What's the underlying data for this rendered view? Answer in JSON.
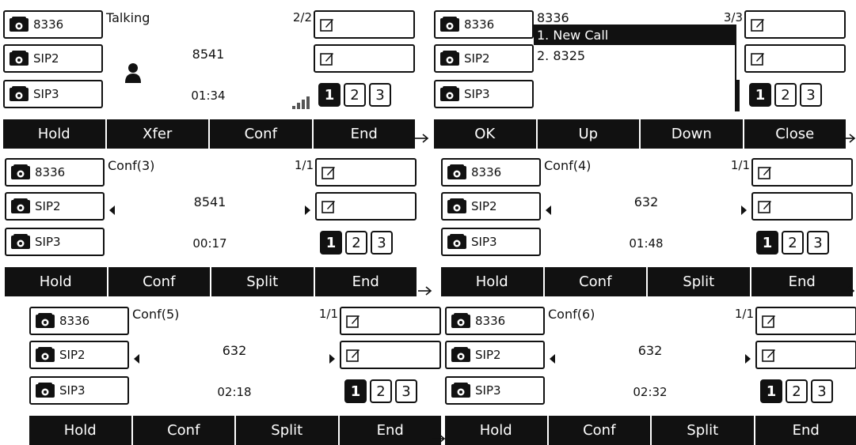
{
  "screens": [
    {
      "accounts": [
        "8336",
        "SIP2",
        "SIP3"
      ],
      "title": "Talking",
      "count": "2/2",
      "number": "8541",
      "time": "01:34",
      "pages": [
        "1",
        "2",
        "3"
      ],
      "softkeys": [
        "Hold",
        "Xfer",
        "Conf",
        "End"
      ]
    },
    {
      "accounts": [
        "8336",
        "SIP2",
        "SIP3"
      ],
      "title": "8336",
      "count": "3/3",
      "menu_items": [
        "1. New Call",
        "2. 8325"
      ],
      "pages": [
        "1",
        "2",
        "3"
      ],
      "softkeys": [
        "OK",
        "Up",
        "Down",
        "Close"
      ]
    },
    {
      "accounts": [
        "8336",
        "SIP2",
        "SIP3"
      ],
      "title": "Conf(3)",
      "count": "1/1",
      "number": "8541",
      "time": "00:17",
      "pages": [
        "1",
        "2",
        "3"
      ],
      "softkeys": [
        "Hold",
        "Conf",
        "Split",
        "End"
      ]
    },
    {
      "accounts": [
        "8336",
        "SIP2",
        "SIP3"
      ],
      "title": "Conf(4)",
      "count": "1/1",
      "number": "632",
      "time": "01:48",
      "pages": [
        "1",
        "2",
        "3"
      ],
      "softkeys": [
        "Hold",
        "Conf",
        "Split",
        "End"
      ]
    },
    {
      "accounts": [
        "8336",
        "SIP2",
        "SIP3"
      ],
      "title": "Conf(5)",
      "count": "1/1",
      "number": "632",
      "time": "02:18",
      "pages": [
        "1",
        "2",
        "3"
      ],
      "softkeys": [
        "Hold",
        "Conf",
        "Split",
        "End"
      ]
    },
    {
      "accounts": [
        "8336",
        "SIP2",
        "SIP3"
      ],
      "title": "Conf(6)",
      "count": "1/1",
      "number": "632",
      "time": "02:32",
      "pages": [
        "1",
        "2",
        "3"
      ],
      "softkeys": [
        "Hold",
        "Conf",
        "Split",
        "End"
      ]
    }
  ],
  "icons": {
    "account": "phone-icon",
    "line_key": "edit-icon",
    "caller": "person-icon",
    "signal": "signal-icon",
    "flow": "arrow-right-icon"
  },
  "colors": {
    "background": "#ffffff",
    "foreground": "#111111"
  },
  "active_page_index": 0
}
